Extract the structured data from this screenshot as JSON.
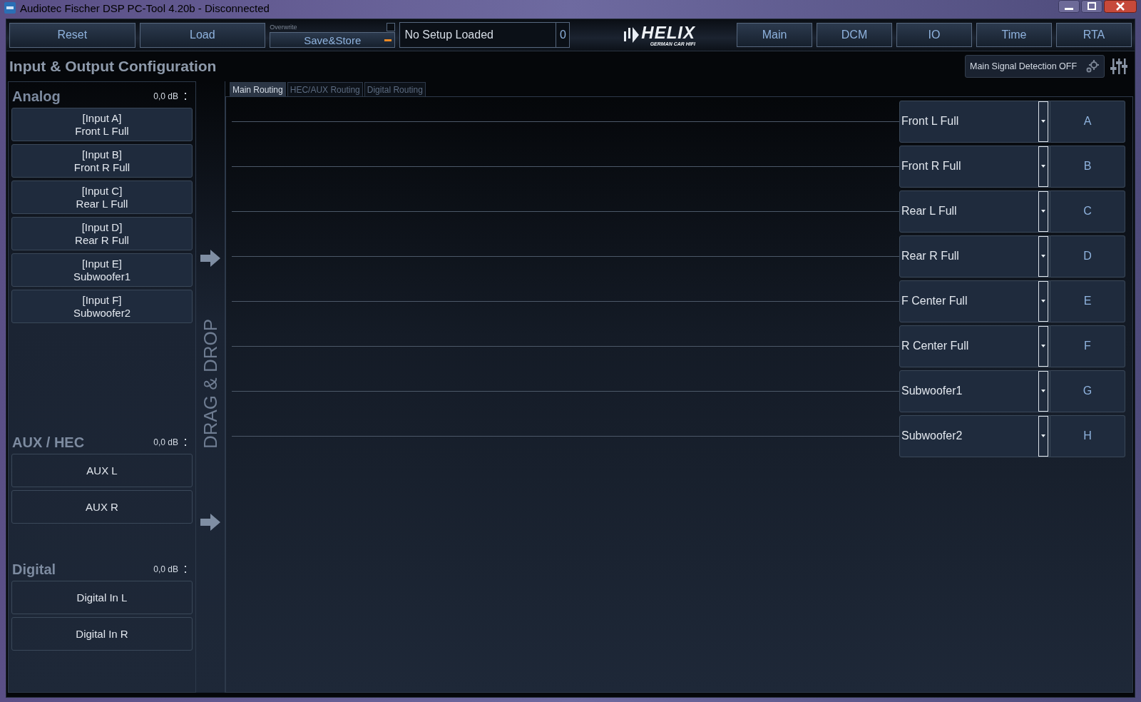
{
  "window": {
    "title": "Audiotec Fischer DSP PC-Tool 4.20b - Disconnected"
  },
  "toolbar": {
    "buttons": [
      "Reset",
      "Load"
    ],
    "overwrite": {
      "label": "Overwrite",
      "checked": false
    },
    "save_button": "Save&Store",
    "setup_name": "No Setup Loaded",
    "setup_count": "0",
    "logo": {
      "brand": "HELIX",
      "tagline": "GERMAN CAR HIFI"
    },
    "nav_tabs": [
      {
        "label": "Main",
        "selected": false
      },
      {
        "label": "DCM",
        "selected": false
      },
      {
        "label": "IO",
        "selected": false
      },
      {
        "label": "Time",
        "selected": false
      },
      {
        "label": "RTA",
        "selected": false
      }
    ]
  },
  "page": {
    "heading": "Input & Output Configuration",
    "signal_detection": "Main Signal Detection OFF"
  },
  "input_groups": [
    {
      "name": "Analog",
      "gain": "0,0 dB",
      "inputs": [
        [
          "[Input A]",
          "Front L Full"
        ],
        [
          "[Input B]",
          "Front R Full"
        ],
        [
          "[Input C]",
          "Rear L Full"
        ],
        [
          "[Input D]",
          "Rear R Full"
        ],
        [
          "[Input E]",
          "Subwoofer1"
        ],
        [
          "[Input F]",
          "Subwoofer2"
        ]
      ]
    },
    {
      "name": "AUX / HEC",
      "gain": "0,0 dB",
      "inputs": [
        [
          "AUX L"
        ],
        [
          "AUX R"
        ]
      ]
    },
    {
      "name": "Digital",
      "gain": "0,0 dB",
      "inputs": [
        [
          "Digital In L"
        ],
        [
          "Digital In R"
        ]
      ]
    }
  ],
  "drag_hint": "DRAG & DROP",
  "routing_tabs": [
    {
      "label": "Main Routing",
      "selected": true
    },
    {
      "label": "HEC/AUX Routing",
      "selected": false
    },
    {
      "label": "Digital Routing",
      "selected": false
    }
  ],
  "outputs": [
    {
      "source": "Front L Full",
      "channel": "A"
    },
    {
      "source": "Front R Full",
      "channel": "B"
    },
    {
      "source": "Rear L Full",
      "channel": "C"
    },
    {
      "source": "Rear R Full",
      "channel": "D"
    },
    {
      "source": "F Center Full",
      "channel": "E"
    },
    {
      "source": "R Center Full",
      "channel": "F"
    },
    {
      "source": "Subwoofer1",
      "channel": "G"
    },
    {
      "source": "Subwoofer2",
      "channel": "H"
    }
  ]
}
